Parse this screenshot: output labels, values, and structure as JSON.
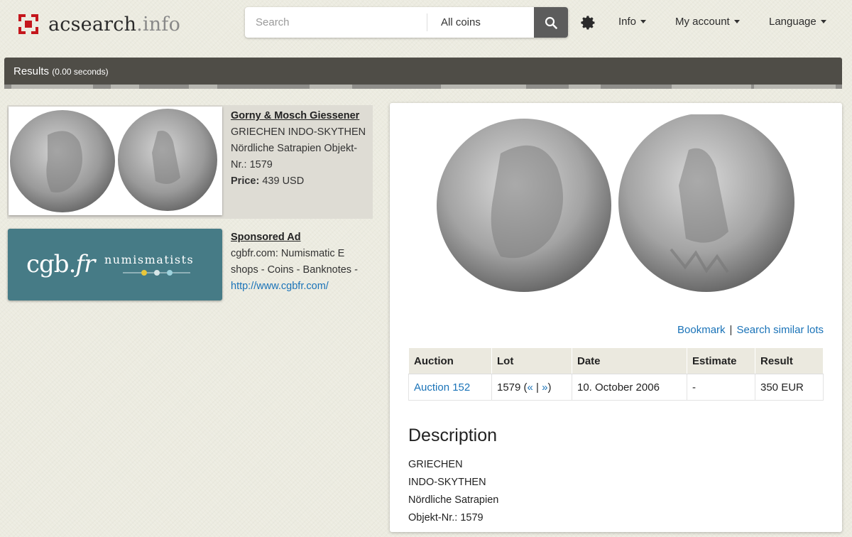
{
  "header": {
    "logo_name": "acsearch",
    "logo_ext": ".info",
    "search_placeholder": "Search",
    "search_scope": "All coins",
    "nav": [
      {
        "label": "Info"
      },
      {
        "label": "My account"
      },
      {
        "label": "Language"
      }
    ]
  },
  "results": {
    "label": "Results",
    "time": "(0.00 seconds)"
  },
  "list": [
    {
      "title": "Gorny & Mosch Giessener",
      "description": "GRIECHEN INDO-SKYTHEN Nördliche Satrapien Objekt-Nr.: 1579",
      "price_label": "Price:",
      "price_value": "439 USD"
    }
  ],
  "ad": {
    "title": "Sponsored Ad",
    "text": "cgbfr.com: Numismatic E shops - Coins - Banknotes -",
    "link": "http://www.cgbfr.com/",
    "logo_main_a": "cgb.",
    "logo_main_b": "fr",
    "logo_sub": "numismatists",
    "brand_color": "#467b86"
  },
  "detail": {
    "bookmark": "Bookmark",
    "separator": "|",
    "search_similar": "Search similar lots",
    "columns": [
      "Auction",
      "Lot",
      "Date",
      "Estimate",
      "Result"
    ],
    "row": {
      "auction": "Auction 152",
      "lot_number": "1579 (",
      "lot_prev": "«",
      "lot_sep": " | ",
      "lot_next": "»",
      "lot_close": ")",
      "date": "10. October 2006",
      "estimate": "-",
      "result": "350 EUR"
    },
    "description_title": "Description",
    "description_lines": [
      "GRIECHEN",
      "INDO-SKYTHEN",
      "Nördliche Satrapien",
      "Objekt-Nr.: 1579"
    ]
  },
  "colors": {
    "brand_red": "#c4161c",
    "results_bar": "#4f4d47",
    "link_blue": "#1a73b8",
    "search_button": "#5c5c5c"
  }
}
